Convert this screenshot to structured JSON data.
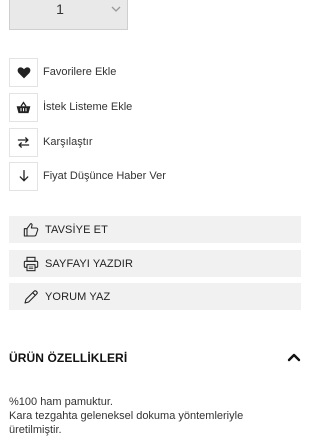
{
  "quantity": {
    "value": "1"
  },
  "actions": [
    {
      "label": "Favorilere Ekle",
      "icon": "heart-icon"
    },
    {
      "label": "İstek Listeme Ekle",
      "icon": "basket-icon"
    },
    {
      "label": "Karşılaştır",
      "icon": "compare-arrows-icon"
    },
    {
      "label": "Fiyat Düşünce Haber Ver",
      "icon": "arrow-down-icon"
    }
  ],
  "buttons": {
    "recommend": "TAVSİYE ET",
    "print": "SAYFAYI YAZDIR",
    "review": "YORUM YAZ"
  },
  "features": {
    "title": "ÜRÜN ÖZELLİKLERİ",
    "lines": [
      "%100 ham pamuktur.",
      "Kara tezgahta geleneksel dokuma yöntemleriyle",
      "üretilmiştir."
    ]
  }
}
